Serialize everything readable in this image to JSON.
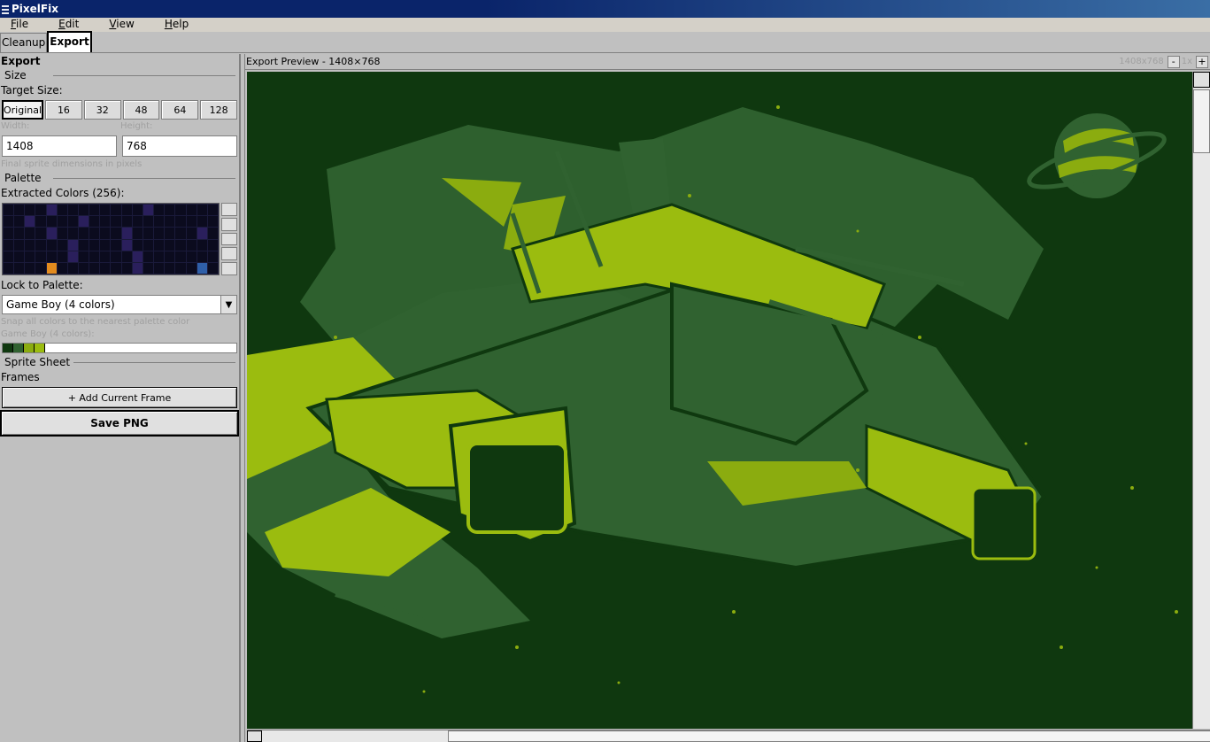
{
  "window": {
    "title": "PixelFix"
  },
  "menu": [
    {
      "label": "File",
      "mnemonic": "F",
      "rest": "ile"
    },
    {
      "label": "Edit",
      "mnemonic": "E",
      "rest": "dit"
    },
    {
      "label": "View",
      "mnemonic": "V",
      "rest": "iew"
    },
    {
      "label": "Help",
      "mnemonic": "H",
      "rest": "elp"
    }
  ],
  "tabs": [
    {
      "label": "Cleanup",
      "active": false
    },
    {
      "label": "Export",
      "active": true
    }
  ],
  "sidebar": {
    "title": "Export",
    "size": {
      "header": "Size",
      "target_label": "Target Size:",
      "options": [
        "Original",
        "16",
        "32",
        "48",
        "64",
        "128"
      ],
      "selected": "Original",
      "width_label": "Width:",
      "height_label": "Height:",
      "width_value": "1408",
      "height_value": "768",
      "hint": "Final sprite dimensions in pixels"
    },
    "palette": {
      "header": "Palette",
      "extracted_label": "Extracted Colors (256):",
      "lock_label": "Lock to Palette:",
      "lock_value": "Game Boy (4 colors)",
      "snap_hint": "Snap all colors to the nearest palette color",
      "palette_name": "Game Boy (4 colors):",
      "colors": [
        "#0f380f",
        "#306230",
        "#8bac0f",
        "#9bbc0f"
      ]
    },
    "sprite_sheet": {
      "header": "Sprite Sheet",
      "frames_label": "Frames",
      "add_frame_button": "+ Add Current Frame"
    },
    "save_button": "Save PNG"
  },
  "preview": {
    "title": "Export Preview - 1408×768",
    "size_readout": "1408x768",
    "zoom_out_label": "-",
    "zoom_level": "1x",
    "zoom_in_label": "+"
  }
}
